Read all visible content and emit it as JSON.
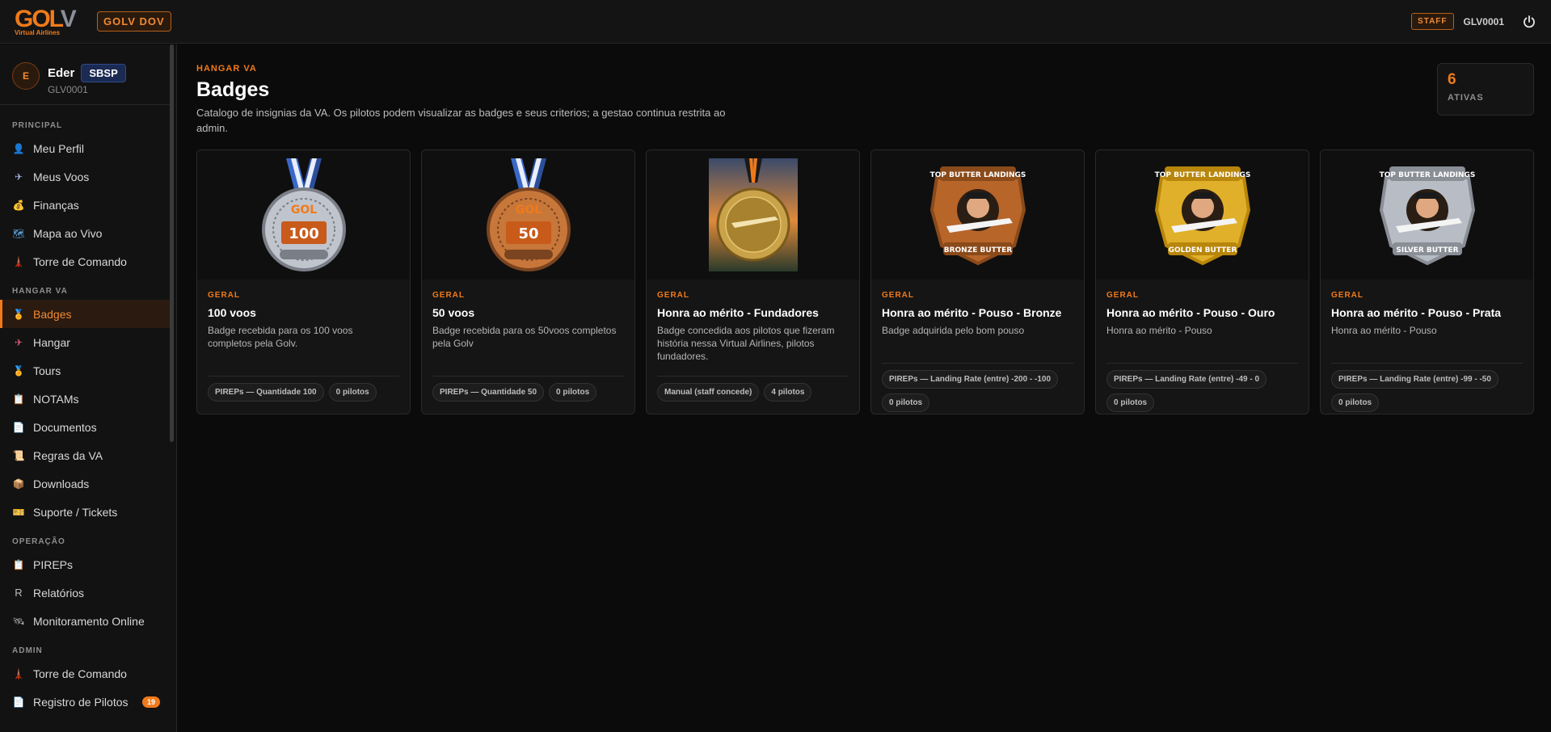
{
  "topbar": {
    "logo_main": "GOL",
    "logo_v": "V",
    "logo_sub": "Virtual Airlines",
    "brand": "GOLV DOV",
    "staff": "STAFF",
    "user_id": "GLV0001"
  },
  "profile": {
    "initial": "E",
    "name": "Eder",
    "icao": "SBSP",
    "id": "GLV0001"
  },
  "sidebar": {
    "sections": [
      {
        "title": "PRINCIPAL",
        "items": [
          {
            "label": "Meu Perfil",
            "icon": "user-icon"
          },
          {
            "label": "Meus Voos",
            "icon": "plane-icon"
          },
          {
            "label": "Finanças",
            "icon": "money-bag-icon"
          },
          {
            "label": "Mapa ao Vivo",
            "icon": "map-icon"
          },
          {
            "label": "Torre de Comando",
            "icon": "tower-icon"
          }
        ]
      },
      {
        "title": "HANGAR VA",
        "items": [
          {
            "label": "Badges",
            "icon": "medal-icon",
            "active": true
          },
          {
            "label": "Hangar",
            "icon": "aircraft-icon"
          },
          {
            "label": "Tours",
            "icon": "medal-icon"
          },
          {
            "label": "NOTAMs",
            "icon": "notes-icon"
          },
          {
            "label": "Documentos",
            "icon": "document-icon"
          },
          {
            "label": "Regras da VA",
            "icon": "scroll-icon"
          },
          {
            "label": "Downloads",
            "icon": "box-icon"
          },
          {
            "label": "Suporte / Tickets",
            "icon": "ticket-icon"
          }
        ]
      },
      {
        "title": "OPERAÇÃO",
        "items": [
          {
            "label": "PIREPs",
            "icon": "clipboard-icon"
          },
          {
            "label": "Relatórios",
            "icon": "r-icon"
          },
          {
            "label": "Monitoramento Online",
            "icon": "satellite-icon"
          }
        ]
      },
      {
        "title": "ADMIN",
        "items": [
          {
            "label": "Torre de Comando",
            "icon": "tower-icon"
          },
          {
            "label": "Registro de Pilotos",
            "icon": "document-icon",
            "badge": "19"
          }
        ]
      }
    ]
  },
  "page": {
    "eyebrow": "HANGAR VA",
    "title": "Badges",
    "description": "Catalogo de insignias da VA. Os pilotos podem visualizar as badges e seus criterios; a gestao continua restrita ao admin.",
    "stat_value": "6",
    "stat_label": "ATIVAS"
  },
  "badges": [
    {
      "category": "GERAL",
      "title": "100 voos",
      "description": "Badge recebida para os 100 voos completos pela Golv.",
      "chips": [
        "PIREPs — Quantidade 100",
        "0 pilotos"
      ],
      "image": "silver-100-medal",
      "accent": "#c0c4cc"
    },
    {
      "category": "GERAL",
      "title": "50 voos",
      "description": "Badge recebida para os 50voos completos pela Golv",
      "chips": [
        "PIREPs — Quantidade 50",
        "0 pilotos"
      ],
      "image": "bronze-50-medal",
      "accent": "#c8773a"
    },
    {
      "category": "GERAL",
      "title": "Honra ao mérito - Fundadores",
      "description": "Badge concedida aos pilotos que fizeram história nessa Virtual Airlines, pilotos fundadores.",
      "chips": [
        "Manual (staff concede)",
        "4 pilotos"
      ],
      "image": "founders-medal",
      "accent": "#c9a24a"
    },
    {
      "category": "GERAL",
      "title": "Honra ao mérito - Pouso - Bronze",
      "description": "Badge adquirida pelo bom pouso",
      "chips": [
        "PIREPs — Landing Rate (entre) -200 - -100",
        "0 pilotos"
      ],
      "image": "bronze-butter-badge",
      "accent": "#b8652a"
    },
    {
      "category": "GERAL",
      "title": "Honra ao mérito - Pouso - Ouro",
      "description": "Honra ao mérito - Pouso",
      "chips": [
        "PIREPs — Landing Rate (entre) -49 - 0",
        "0 pilotos"
      ],
      "image": "golden-butter-badge",
      "accent": "#e0b02a"
    },
    {
      "category": "GERAL",
      "title": "Honra ao mérito - Pouso - Prata",
      "description": "Honra ao mérito - Pouso",
      "chips": [
        "PIREPs — Landing Rate (entre) -99 - -50",
        "0 pilotos"
      ],
      "image": "silver-butter-badge",
      "accent": "#b8bcc4"
    }
  ]
}
